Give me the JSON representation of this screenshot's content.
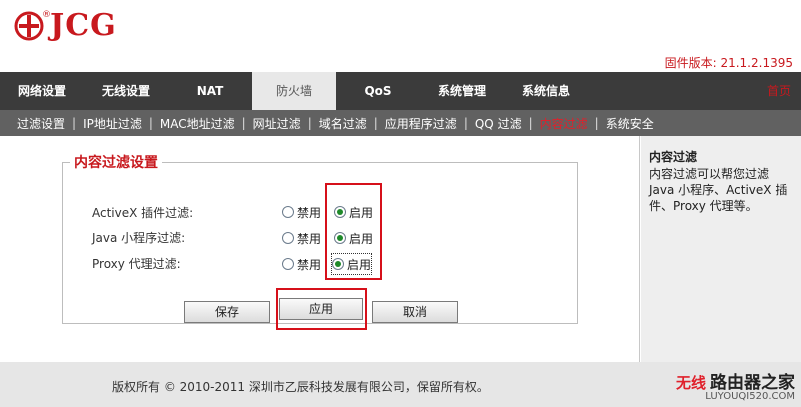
{
  "header": {
    "brand": "JCG",
    "reg_mark": "®",
    "firmware": "固件版本: 21.1.2.1395",
    "brand_color": "#c8191e"
  },
  "main_nav": {
    "tabs": [
      {
        "label": "网络设置"
      },
      {
        "label": "无线设置"
      },
      {
        "label": "NAT"
      },
      {
        "label": "防火墙",
        "active": true
      },
      {
        "label": "QoS"
      },
      {
        "label": "系统管理"
      },
      {
        "label": "系统信息"
      }
    ],
    "home": "首页"
  },
  "sub_nav": {
    "items": [
      {
        "label": "过滤设置"
      },
      {
        "label": "IP地址过滤"
      },
      {
        "label": "MAC地址过滤"
      },
      {
        "label": "网址过滤"
      },
      {
        "label": "域名过滤"
      },
      {
        "label": "应用程序过滤"
      },
      {
        "label": "QQ 过滤"
      },
      {
        "label": "内容过滤",
        "active": true
      },
      {
        "label": "系统安全"
      }
    ],
    "separator": "|"
  },
  "content": {
    "legend": "内容过滤设置",
    "rows": [
      {
        "label": "ActiveX 插件过滤:",
        "disable": "禁用",
        "enable": "启用",
        "selected": "enable"
      },
      {
        "label": "Java 小程序过滤:",
        "disable": "禁用",
        "enable": "启用",
        "selected": "enable"
      },
      {
        "label": "Proxy 代理过滤:",
        "disable": "禁用",
        "enable": "启用",
        "selected": "enable"
      }
    ],
    "buttons": {
      "save": "保存",
      "apply": "应用",
      "cancel": "取消"
    }
  },
  "info": {
    "title": "内容过滤",
    "desc": "内容过滤可以帮您过滤 Java 小程序、ActiveX 插件、Proxy 代理等。"
  },
  "footer": {
    "copyright": "版权所有 © 2010-2011 深圳市乙辰科技发展有限公司，保留所有权。",
    "watermark_red": "无线",
    "watermark_main": "路由器之家",
    "watermark_sub": "LUYOUQI520.COM"
  }
}
